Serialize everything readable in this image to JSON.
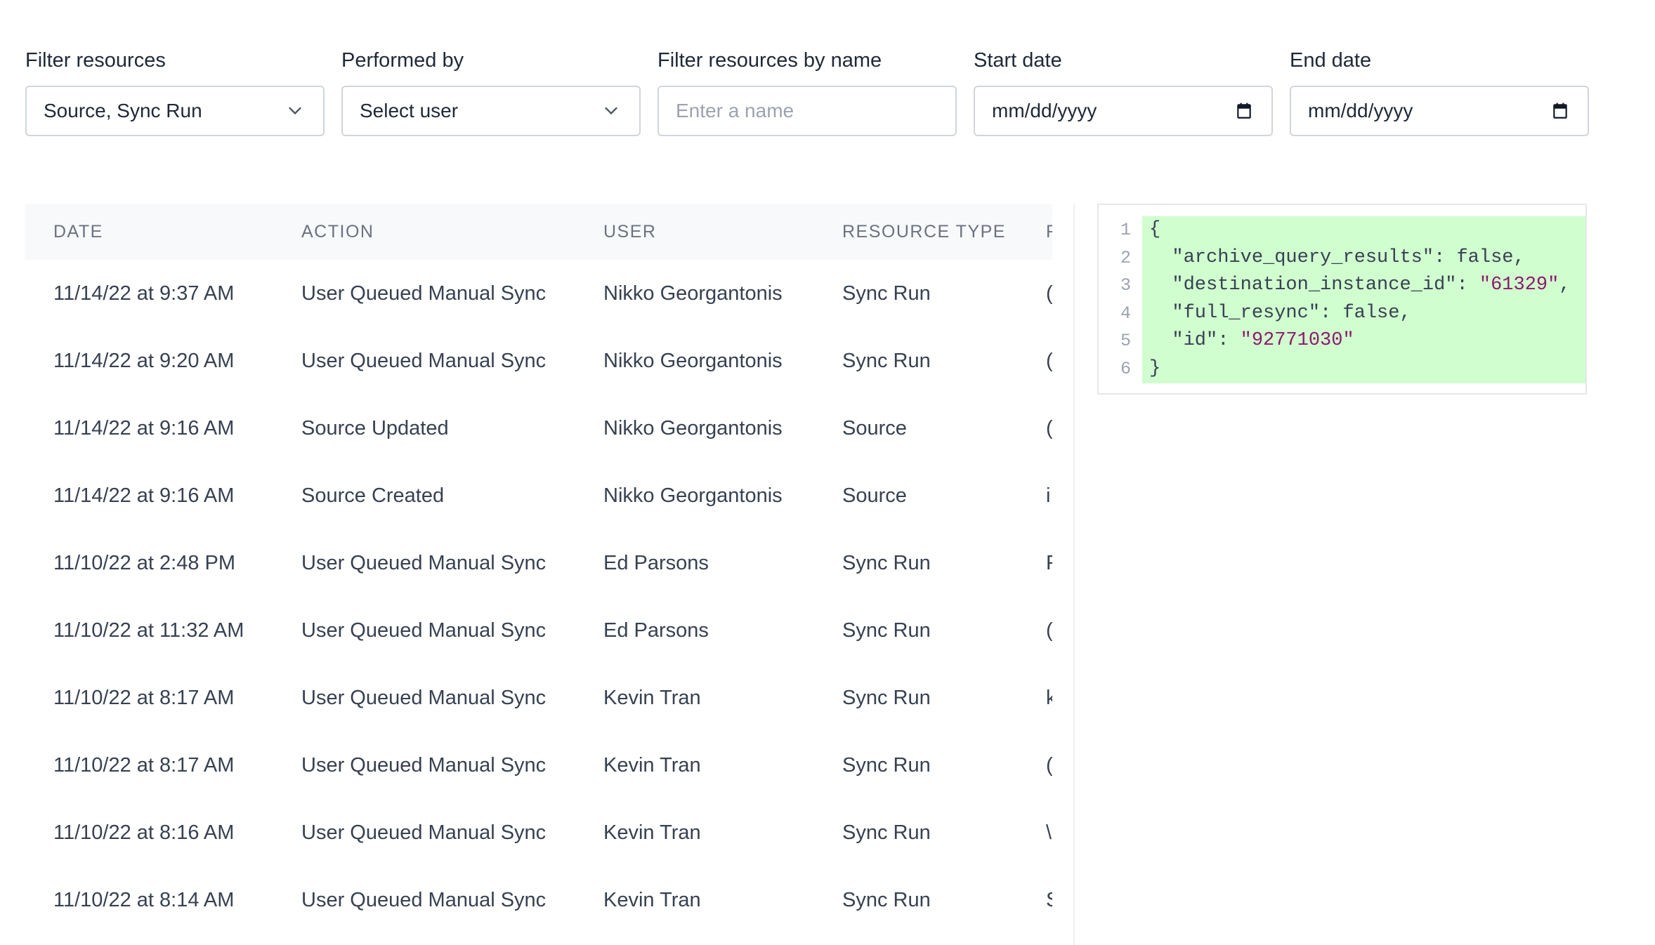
{
  "filters": {
    "resources": {
      "label": "Filter resources",
      "value": "Source, Sync Run"
    },
    "performed_by": {
      "label": "Performed by",
      "value": "Select user"
    },
    "name": {
      "label": "Filter resources by name",
      "placeholder": "Enter a name"
    },
    "start_date": {
      "label": "Start date",
      "value": "mm/dd/yyyy"
    },
    "end_date": {
      "label": "End date",
      "value": "mm/dd/yyyy"
    }
  },
  "table": {
    "headers": [
      "DATE",
      "ACTION",
      "USER",
      "RESOURCE TYPE",
      "F"
    ],
    "rows": [
      [
        "11/14/22 at 9:37 AM",
        "User Queued Manual Sync",
        "Nikko Georgantonis",
        "Sync Run",
        "("
      ],
      [
        "11/14/22 at 9:20 AM",
        "User Queued Manual Sync",
        "Nikko Georgantonis",
        "Sync Run",
        "("
      ],
      [
        "11/14/22 at 9:16 AM",
        "Source Updated",
        "Nikko Georgantonis",
        "Source",
        "("
      ],
      [
        "11/14/22 at 9:16 AM",
        "Source Created",
        "Nikko Georgantonis",
        "Source",
        "i"
      ],
      [
        "11/10/22 at 2:48 PM",
        "User Queued Manual Sync",
        "Ed Parsons",
        "Sync Run",
        "F"
      ],
      [
        "11/10/22 at 11:32 AM",
        "User Queued Manual Sync",
        "Ed Parsons",
        "Sync Run",
        "("
      ],
      [
        "11/10/22 at 8:17 AM",
        "User Queued Manual Sync",
        "Kevin Tran",
        "Sync Run",
        "k"
      ],
      [
        "11/10/22 at 8:17 AM",
        "User Queued Manual Sync",
        "Kevin Tran",
        "Sync Run",
        "("
      ],
      [
        "11/10/22 at 8:16 AM",
        "User Queued Manual Sync",
        "Kevin Tran",
        "Sync Run",
        "\\"
      ],
      [
        "11/10/22 at 8:14 AM",
        "User Queued Manual Sync",
        "Kevin Tran",
        "Sync Run",
        "S"
      ]
    ]
  },
  "code": {
    "line_numbers": [
      "1",
      "2",
      "3",
      "4",
      "5",
      "6"
    ],
    "lines": [
      {
        "text": "{",
        "str": "",
        "tail": ""
      },
      {
        "text": "  \"archive_query_results\": false,",
        "str": "",
        "tail": ""
      },
      {
        "text": "  \"destination_instance_id\": ",
        "str": "\"61329\"",
        "tail": ","
      },
      {
        "text": "  \"full_resync\": false,",
        "str": "",
        "tail": ""
      },
      {
        "text": "  \"id\": ",
        "str": "\"92771030\"",
        "tail": ""
      },
      {
        "text": "}",
        "str": "",
        "tail": ""
      }
    ],
    "colors": {
      "highlight": "#d0fecf",
      "string": "#8b1a6b"
    }
  }
}
